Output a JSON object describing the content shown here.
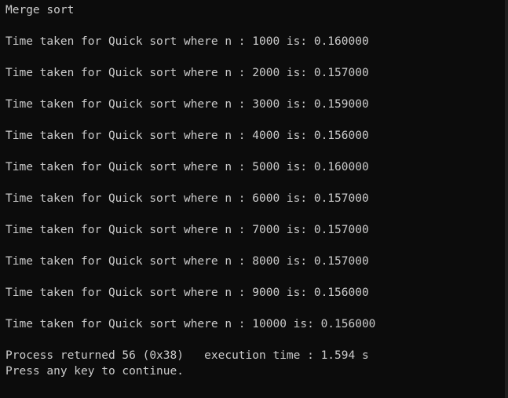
{
  "console": {
    "title": "Merge sort",
    "results": [
      "Time taken for Quick sort where n : 1000 is: 0.160000",
      "Time taken for Quick sort where n : 2000 is: 0.157000",
      "Time taken for Quick sort where n : 3000 is: 0.159000",
      "Time taken for Quick sort where n : 4000 is: 0.156000",
      "Time taken for Quick sort where n : 5000 is: 0.160000",
      "Time taken for Quick sort where n : 6000 is: 0.157000",
      "Time taken for Quick sort where n : 7000 is: 0.157000",
      "Time taken for Quick sort where n : 8000 is: 0.157000",
      "Time taken for Quick sort where n : 9000 is: 0.156000",
      "Time taken for Quick sort where n : 10000 is: 0.156000"
    ],
    "process_line": "Process returned 56 (0x38)   execution time : 1.594 s",
    "prompt_line": "Press any key to continue."
  },
  "colors": {
    "background": "#0c0c0c",
    "text": "#cccccc"
  }
}
